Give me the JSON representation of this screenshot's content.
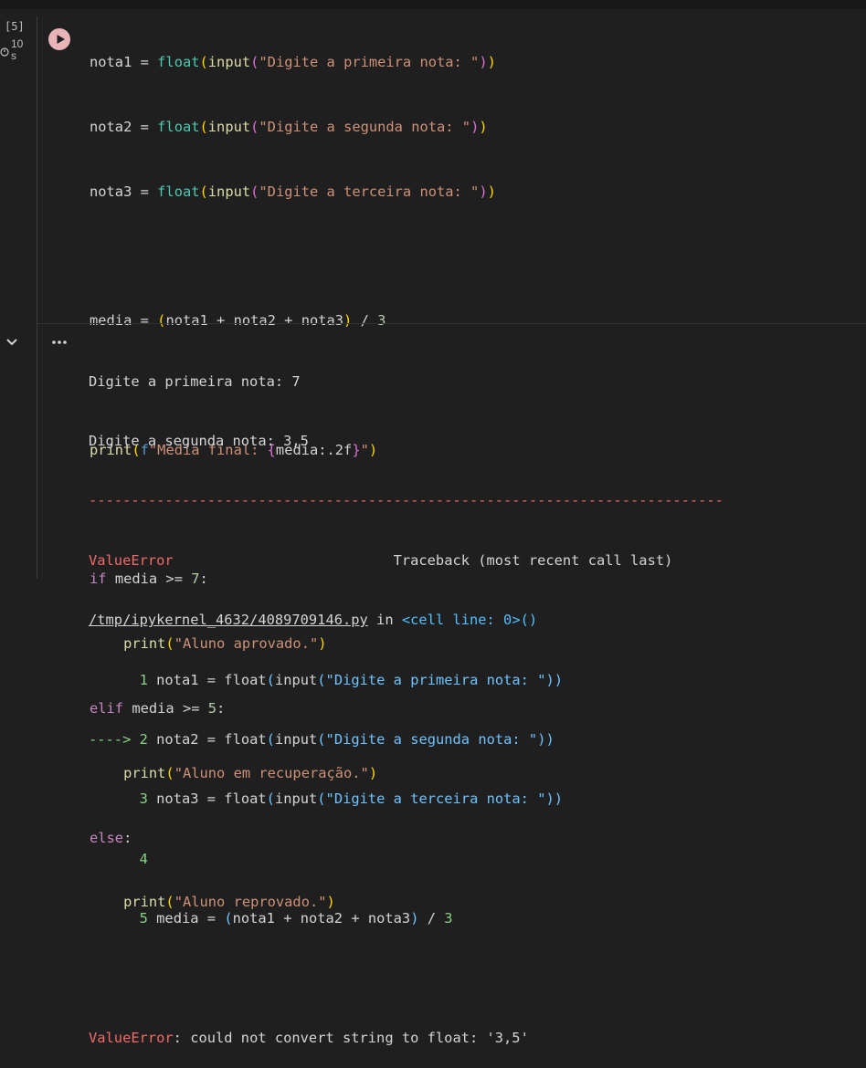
{
  "cell": {
    "exec_count": "[5]",
    "exec_time_value": "10",
    "exec_time_unit": "s"
  },
  "code": {
    "l1_var": "nota1",
    "l1_prompt": "\"Digite a primeira nota: \"",
    "l2_var": "nota2",
    "l2_prompt": "\"Digite a segunda nota: \"",
    "l3_var": "nota3",
    "l3_prompt": "\"Digite a terceira nota: \"",
    "media_lhs": "media",
    "media_expr": "nota1 + nota2 + nota3",
    "divisor": "3",
    "print_prefix": "f",
    "print_text": "\"Média final: ",
    "print_fmt": "media:.2f",
    "print_end": "\"",
    "if_kw": "if",
    "cond1": "media >= ",
    "n7": "7",
    "elif_kw": "elif",
    "n5": "5",
    "else_kw": "else",
    "msg1": "\"Aluno aprovado.\"",
    "msg2": "\"Aluno em recuperação.\"",
    "msg3": "\"Aluno reprovado.\"",
    "float_fn": "float",
    "input_fn": "input",
    "print_fn": "print"
  },
  "output": {
    "line1": "Digite a primeira nota: 7",
    "line2": "Digite a segunda nota: 3,5",
    "dashes": "---------------------------------------------------------------------------",
    "err_name": "ValueError",
    "traceback_label": "Traceback (most recent call last)",
    "file_link": "/tmp/ipykernel_4632/4089709146.py",
    "in_text": " in ",
    "cell_line": "<cell line: 0>()",
    "tb": [
      {
        "marker": "      1",
        "code_var": "nota1",
        "prompt": "\"Digite a primeira nota: \""
      },
      {
        "marker": "----> 2",
        "code_var": "nota2",
        "prompt": "\"Digite a segunda nota: \""
      },
      {
        "marker": "      3",
        "code_var": "nota3",
        "prompt": "\"Digite a terceira nota: \""
      },
      {
        "marker": "      4"
      },
      {
        "marker": "      5",
        "code_var": "media",
        "expr": "nota1 + nota2 + nota3",
        "div": "3"
      }
    ],
    "final_err_name": "ValueError",
    "final_err_msg": ": could not convert string to float: '3,5'"
  },
  "colors": {
    "background": "#1f1f1f",
    "run_button": "#e8b4b8",
    "error": "#f16969"
  },
  "icons": [
    "run-icon",
    "timer-icon",
    "chevron-down-icon",
    "more-horizontal-icon"
  ]
}
